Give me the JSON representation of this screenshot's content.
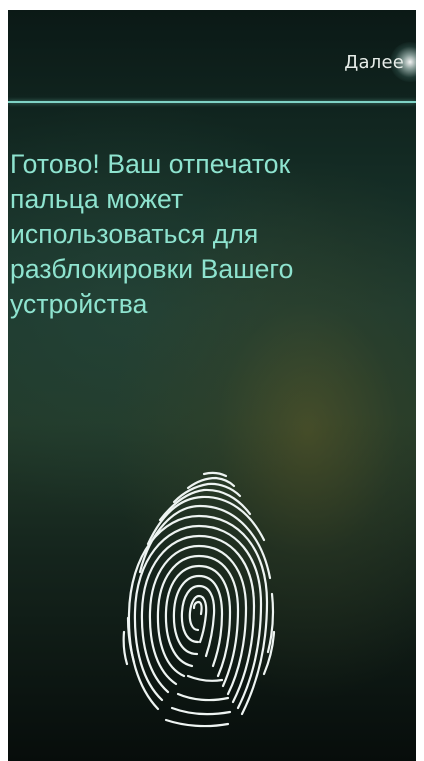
{
  "header": {
    "next_label": "Далее"
  },
  "main": {
    "message": "Готово! Ваш отпечаток пальца может использоваться для разблокировки Вашего устройства"
  },
  "colors": {
    "accent": "#8ee3cf",
    "divider": "#7fd3c6",
    "fingerprint": "#eef4f2"
  },
  "icons": {
    "fingerprint": "fingerprint-icon"
  }
}
